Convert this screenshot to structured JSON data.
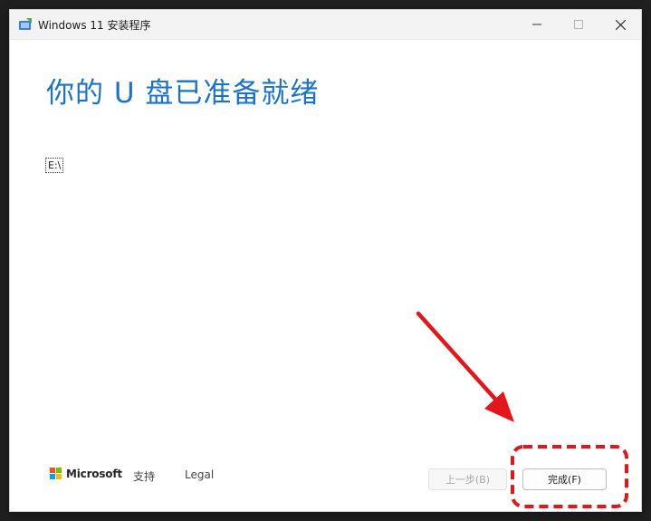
{
  "window": {
    "title": "Windows 11 安装程序",
    "controls": {
      "minimize": "minimize-icon",
      "maximize": "maximize-icon",
      "close": "close-icon"
    }
  },
  "main": {
    "heading": "你的 U 盘已准备就绪",
    "drives": [
      "E:\\"
    ]
  },
  "footer": {
    "brand": "Microsoft",
    "links": [
      "支持",
      "Legal"
    ],
    "back_label": "上一步(B)",
    "finish_label": "完成(F)"
  },
  "colors": {
    "heading": "#1a73c8",
    "annotation": "#e3161b",
    "ms_red": "#f25022",
    "ms_green": "#7fba00",
    "ms_blue": "#00a4ef",
    "ms_yellow": "#ffb900"
  }
}
